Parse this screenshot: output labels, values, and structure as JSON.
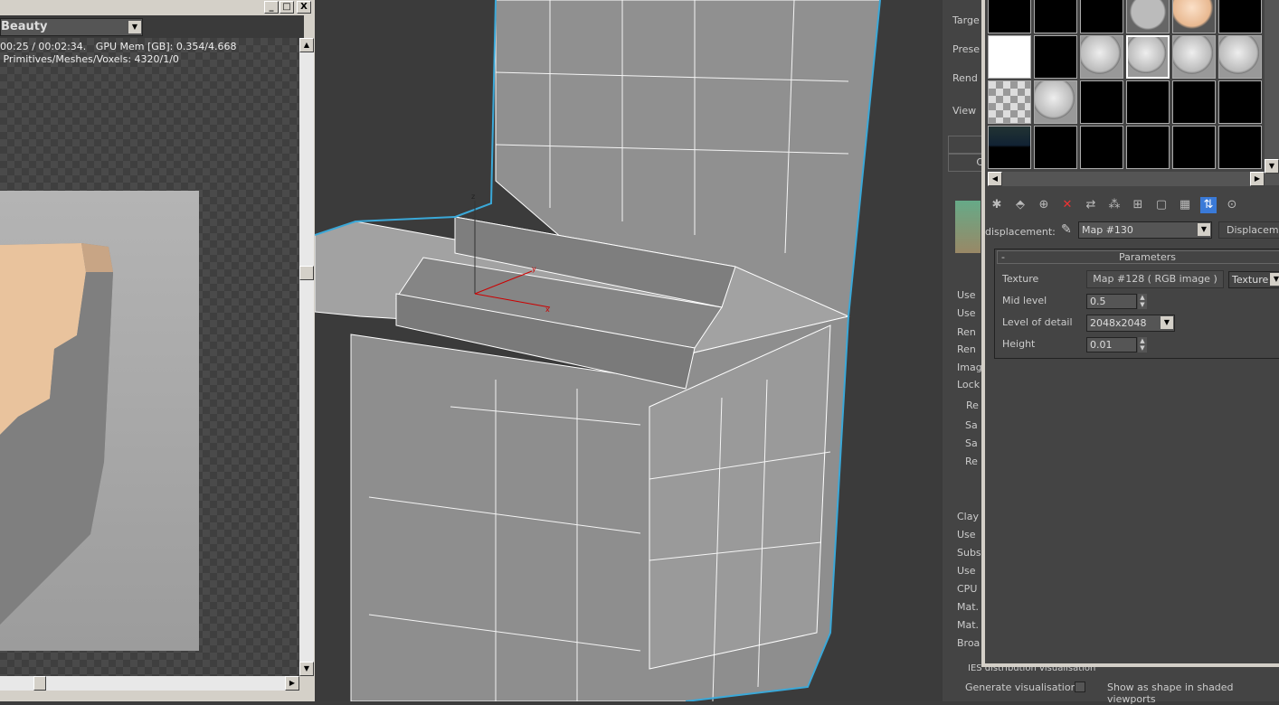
{
  "render_window": {
    "channel": "Beauty",
    "stats_line1": "00:25 / 00:02:34.   GPU Mem [GB]: 0.354/4.668",
    "stats_line2": " Primitives/Meshes/Voxels: 4320/1/0",
    "buttons": {
      "minimize": "_",
      "maximize": "□",
      "close": "X"
    }
  },
  "viewport": {
    "axis_labels": {
      "x": "x",
      "y": "y",
      "z": "z"
    },
    "selection_color": "#3aa8d8"
  },
  "right_panel": {
    "labels": [
      "Targe",
      "Prese",
      "Rend",
      "View"
    ],
    "labels2": [
      "Use",
      "Use",
      "Ren",
      "Ren",
      "Imag",
      "Lock"
    ],
    "group_re": "Re",
    "group_items": [
      "Sa",
      "Sa",
      "Re"
    ],
    "labels3": [
      "Clay",
      "Use",
      "Subs",
      "Use",
      "CPU",
      "Mat.",
      "Mat.",
      "Broa"
    ],
    "button_c": "C",
    "ies_title": "IES distribution visualisation",
    "generate_vis": "Generate visualisation",
    "show_shape": "Show as shape in shaded viewports"
  },
  "material_editor": {
    "slots": [
      [
        "black",
        "black",
        "black",
        "checker-sphere",
        "skin-sphere",
        "black"
      ],
      [
        "white",
        "black",
        "sphere",
        "sphere-selected",
        "sphere",
        "sphere"
      ],
      [
        "checker",
        "sphere",
        "black",
        "black",
        "black",
        "black"
      ],
      [
        "env",
        "black",
        "black",
        "black",
        "black",
        "black"
      ]
    ],
    "toolbar_icons": [
      "get-material-icon",
      "put-to-scene-icon",
      "assign-to-selection-icon",
      "reset-icon",
      "copy-material-icon",
      "make-unique-icon",
      "put-to-library-icon",
      "material-id-icon",
      "show-map-icon",
      "show-end-result-icon",
      "go-to-parent-icon"
    ],
    "map_label": "displacement:",
    "map_name": "Map #130",
    "map_type": "Displacement",
    "rollout_toggle": "-",
    "rollout_title": "Parameters",
    "params": {
      "texture_label": "Texture",
      "texture_value": "Map #128  ( RGB image )",
      "texture_mode": "Texture",
      "mid_label": "Mid level",
      "mid_value": "0.5",
      "lod_label": "Level of detail",
      "lod_value": "2048x2048",
      "height_label": "Height",
      "height_value": "0.01"
    }
  }
}
